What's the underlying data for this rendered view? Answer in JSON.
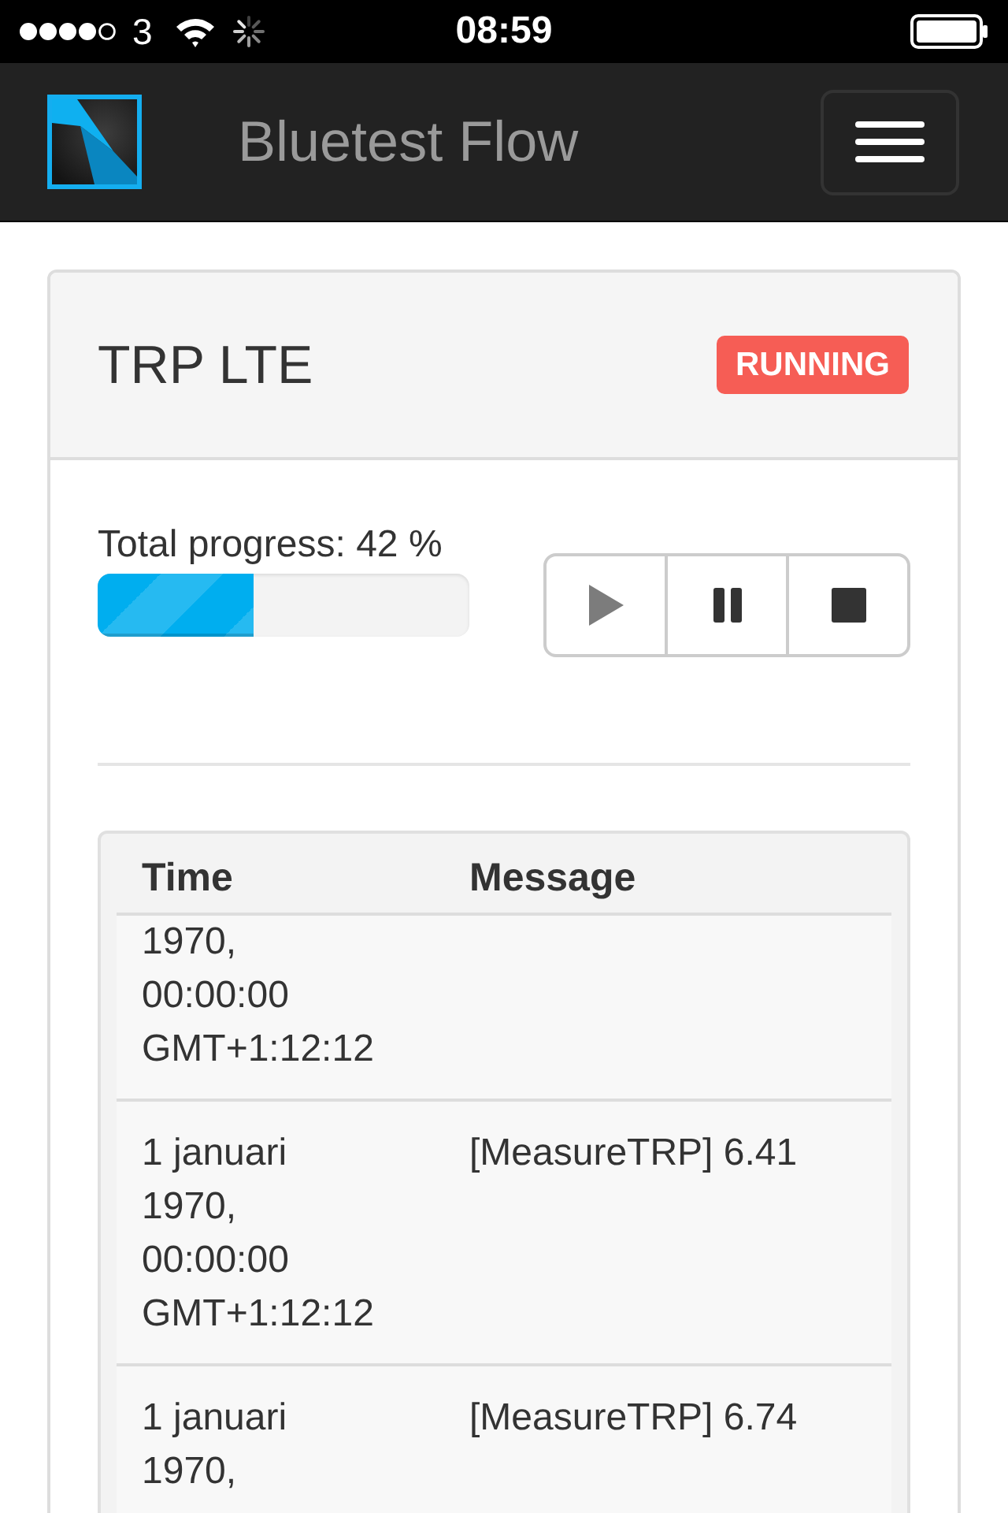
{
  "status_bar": {
    "carrier": "3",
    "time": "08:59"
  },
  "navbar": {
    "title": "Bluetest Flow"
  },
  "panel": {
    "title": "TRP LTE",
    "status": "RUNNING"
  },
  "progress": {
    "label": "Total progress: 42 %",
    "level": 0.42
  },
  "controls": [
    {
      "kind": "play",
      "disabled": true
    },
    {
      "kind": "pause",
      "disabled": false
    },
    {
      "kind": "stop",
      "disabled": false
    }
  ],
  "log": {
    "columns": [
      "Time",
      "Message"
    ],
    "rows": [
      {
        "time": "1970, 00:00:00 GMT+1:12:12"
      },
      {
        "time": "1 januari 1970, 00:00:00 GMT+1:12:12",
        "message": "[MeasureTRP] 6.41"
      },
      {
        "time": "1 januari 1970,",
        "message": "[MeasureTRP] 6.74"
      }
    ]
  }
}
